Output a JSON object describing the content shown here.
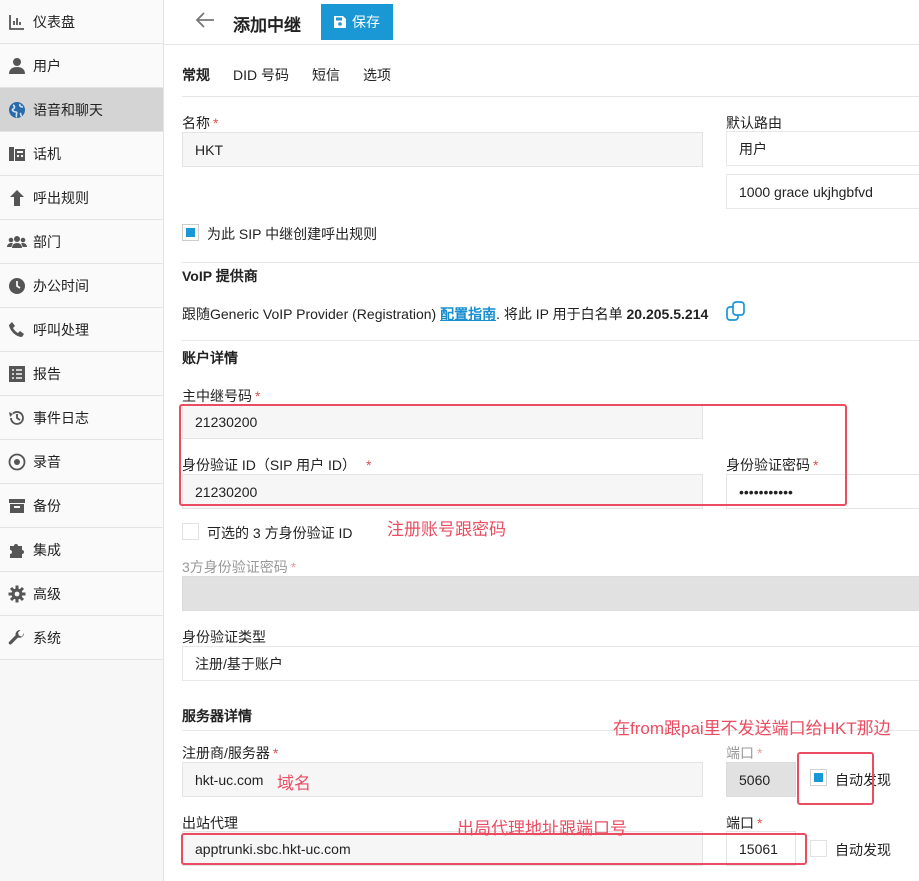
{
  "sidebar": {
    "items": [
      {
        "label": "仪表盘",
        "icon": "dashboard-icon"
      },
      {
        "label": "用户",
        "icon": "user-icon"
      },
      {
        "label": "语音和聊天",
        "icon": "globe-icon",
        "active": true
      },
      {
        "label": "话机",
        "icon": "phone-device-icon"
      },
      {
        "label": "呼出规则",
        "icon": "arrow-up-icon"
      },
      {
        "label": "部门",
        "icon": "group-icon"
      },
      {
        "label": "办公时间",
        "icon": "clock-icon"
      },
      {
        "label": "呼叫处理",
        "icon": "phone-icon"
      },
      {
        "label": "报告",
        "icon": "list-icon"
      },
      {
        "label": "事件日志",
        "icon": "history-icon"
      },
      {
        "label": "录音",
        "icon": "record-icon"
      },
      {
        "label": "备份",
        "icon": "archive-icon"
      },
      {
        "label": "集成",
        "icon": "puzzle-icon"
      },
      {
        "label": "高级",
        "icon": "gear-icon"
      },
      {
        "label": "系统",
        "icon": "wrench-icon"
      }
    ]
  },
  "header": {
    "title": "添加中继",
    "save_label": "保存"
  },
  "tabs": [
    "常规",
    "DID 号码",
    "短信",
    "选项"
  ],
  "general": {
    "name_label": "名称",
    "name_value": "HKT",
    "default_route_label": "默认路由",
    "default_route_type": "用户",
    "default_route_target": "1000 grace ukjhgbfvd",
    "create_rule_label": "为此 SIP 中继创建呼出规则"
  },
  "voip": {
    "title": "VoIP 提供商",
    "text_before": "跟随Generic VoIP Provider (Registration) ",
    "link": "配置指南",
    "text_middle": ". 将此 IP 用于白名单 ",
    "ip": "20.205.5.214"
  },
  "account": {
    "title": "账户详情",
    "main_number_label": "主中继号码",
    "main_number_value": "21230200",
    "auth_id_label": "身份验证 ID（SIP 用户 ID）",
    "auth_id_value": "21230200",
    "auth_password_label": "身份验证密码",
    "auth_password_value": "•••••••••••",
    "third_party_label": "可选的 3 方身份验证 ID",
    "third_party_password_label": "3方身份验证密码",
    "auth_type_label": "身份验证类型",
    "auth_type_value": "注册/基于账户"
  },
  "server": {
    "title": "服务器详情",
    "registrar_label": "注册商/服务器",
    "registrar_value": "hkt-uc.com",
    "port_label": "端口",
    "registrar_port_value": "5060",
    "auto_discover_label": "自动发现",
    "outbound_proxy_label": "出站代理",
    "outbound_proxy_value": "apptrunki.sbc.hkt-uc.com",
    "proxy_port_label": "端口",
    "proxy_port_value": "15061",
    "proxy_auto_discover_label": "自动发现"
  },
  "annotations": {
    "account_note": "注册账号跟密码",
    "port_note": "在from跟pai里不发送端口给HKT那边",
    "domain_note": "域名",
    "proxy_note": "出局代理地址跟端口号"
  },
  "colors": {
    "accent": "#1a98d5",
    "annotation": "#ea4d62",
    "active_nav": "#d4d4d4"
  }
}
